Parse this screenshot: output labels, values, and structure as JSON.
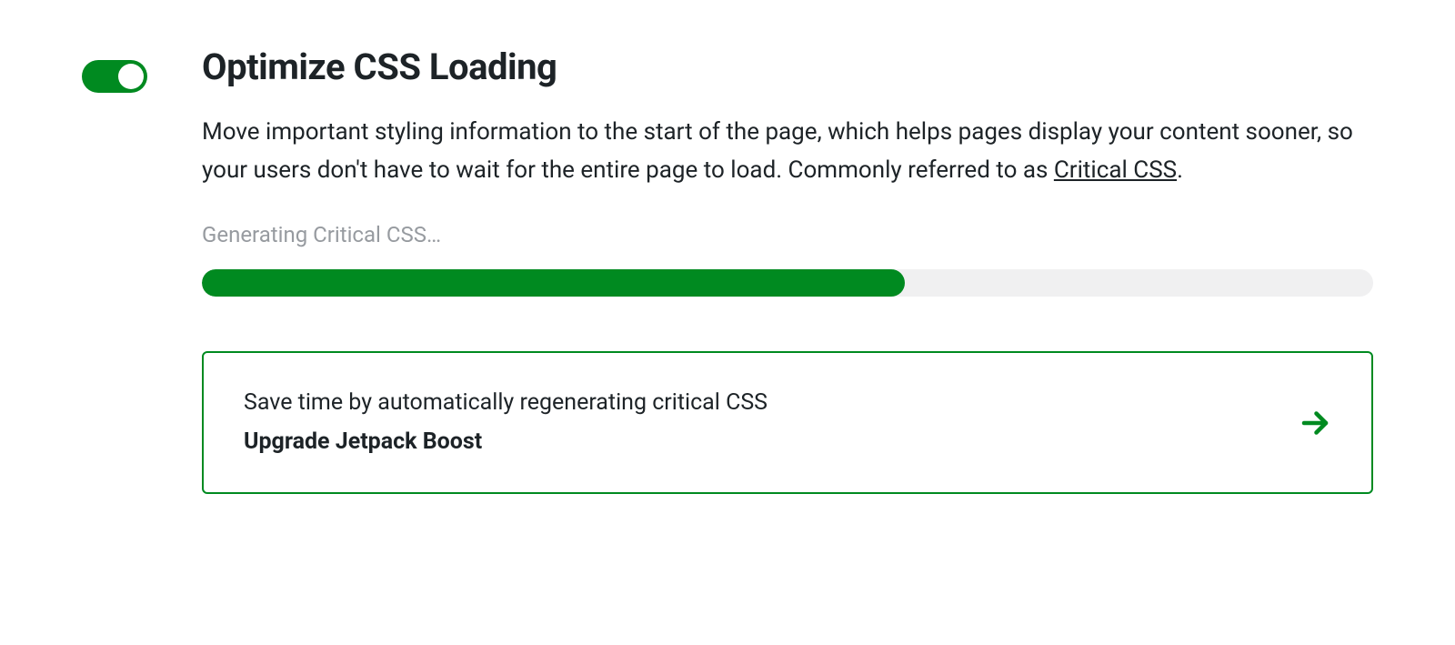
{
  "toggle": {
    "enabled": true
  },
  "heading": "Optimize CSS Loading",
  "description_before": "Move important styling information to the start of the page, which helps pages display your content sooner, so your users don't have to wait for the entire page to load. Commonly referred to as ",
  "description_link": "Critical CSS",
  "description_after": ".",
  "status_text": "Generating Critical CSS…",
  "progress_percent": 60,
  "upsell": {
    "description": "Save time by automatically regenerating critical CSS",
    "cta": "Upgrade Jetpack Boost"
  },
  "colors": {
    "accent": "#008a20",
    "text": "#1d2327",
    "muted": "#979ba0",
    "track": "#f0f0f1"
  }
}
